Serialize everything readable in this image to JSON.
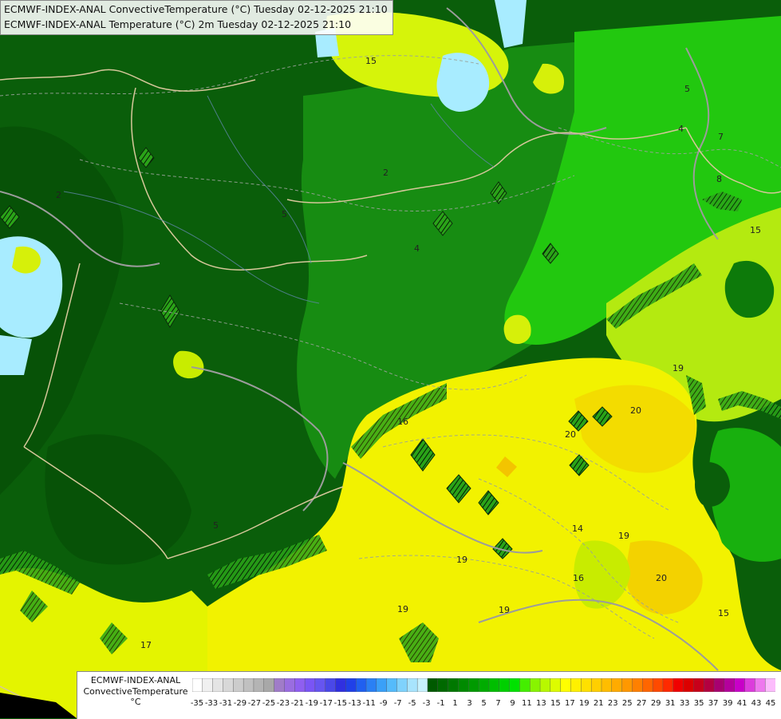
{
  "title": {
    "line1": "ECMWF-INDEX-ANAL ConvectiveTemperature (°C) Tuesday 02-12-2025 21:10",
    "line2": "ECMWF-INDEX-ANAL Temperature (°C) 2m Tuesday 02-12-2025 21:10"
  },
  "legend": {
    "model": "ECMWF-INDEX-ANAL",
    "variable": "ConvectiveTemperature",
    "unit": "°C",
    "ticks": [
      "-35",
      "-33",
      "-31",
      "-29",
      "-27",
      "-25",
      "-23",
      "-21",
      "-19",
      "-17",
      "-15",
      "-13",
      "-11",
      "-9",
      "-7",
      "-5",
      "-3",
      "-1",
      "1",
      "3",
      "5",
      "7",
      "9",
      "11",
      "13",
      "15",
      "17",
      "19",
      "21",
      "23",
      "25",
      "27",
      "29",
      "31",
      "33",
      "35",
      "37",
      "39",
      "41",
      "43",
      "45"
    ],
    "colors": [
      "#ffffff",
      "#f0f0f0",
      "#e4e4e4",
      "#d8d8d8",
      "#cccccc",
      "#c0c0c0",
      "#b4b4b4",
      "#a8a8a8",
      "#a07cc8",
      "#9a6de0",
      "#8f5ff0",
      "#7a55f5",
      "#6655f0",
      "#4a48e8",
      "#3030e0",
      "#2040e8",
      "#2060f0",
      "#2a80f4",
      "#3aa0f8",
      "#55bbfb",
      "#7fd2fc",
      "#a8e4fd",
      "#c8f2fe",
      "#005a00",
      "#006900",
      "#007800",
      "#008a00",
      "#009a00",
      "#00ac00",
      "#00be00",
      "#00d000",
      "#00e200",
      "#44ee00",
      "#88f400",
      "#b8f800",
      "#ddfc00",
      "#ffff00",
      "#fff000",
      "#ffe000",
      "#ffcf00",
      "#ffbd00",
      "#ffab00",
      "#ff9800",
      "#ff8000",
      "#ff6600",
      "#ff4a00",
      "#ff2a00",
      "#f00000",
      "#dc0000",
      "#c8001a",
      "#b40040",
      "#a80070",
      "#b4009c",
      "#c800c8",
      "#dc3cdc",
      "#ee78ee",
      "#fcbcfc"
    ]
  },
  "contour_labels": [
    {
      "text": "15"
    },
    {
      "text": "5"
    },
    {
      "text": "4"
    },
    {
      "text": "7"
    },
    {
      "text": "8"
    },
    {
      "text": "15"
    },
    {
      "text": "2"
    },
    {
      "text": "5"
    },
    {
      "text": "4"
    },
    {
      "text": "2"
    },
    {
      "text": "19"
    },
    {
      "text": "20"
    },
    {
      "text": "20"
    },
    {
      "text": "14"
    },
    {
      "text": "19"
    },
    {
      "text": "19"
    },
    {
      "text": "19"
    },
    {
      "text": "20"
    },
    {
      "text": "16"
    },
    {
      "text": "19"
    },
    {
      "text": "15"
    },
    {
      "text": "5"
    },
    {
      "text": "16"
    },
    {
      "text": "17"
    }
  ],
  "palette": {
    "dark_green": "#0a5e0a",
    "mid_green": "#1f8a14",
    "bright_green": "#22cc10",
    "yellow_green": "#c8f000",
    "yellow": "#f4f400",
    "warm_yellow": "#f2d600",
    "light_blue": "#a8ecff",
    "border": "#d8c89a",
    "contour": "#a0a0a0"
  }
}
